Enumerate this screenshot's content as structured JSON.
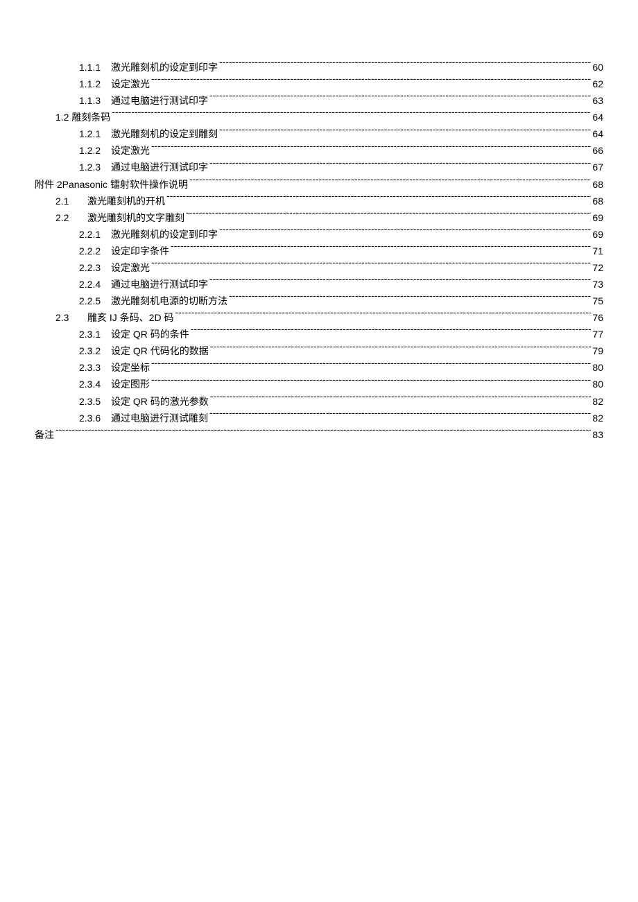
{
  "toc": [
    {
      "level": 2,
      "num": "1.1.1",
      "label": "激光雕刻机的设定到印字",
      "page": "60"
    },
    {
      "level": 2,
      "num": "1.1.2",
      "label": "设定激光",
      "page": "62"
    },
    {
      "level": 2,
      "num": "1.1.3",
      "label": "通过电脑进行测试印字",
      "page": "63"
    },
    {
      "level": 1,
      "num": "1.2",
      "label": "雕刻条码",
      "page": "64",
      "joinNum": true
    },
    {
      "level": 2,
      "num": "1.2.1",
      "label": "激光雕刻机的设定到雕刻",
      "page": "64"
    },
    {
      "level": 2,
      "num": "1.2.2",
      "label": "设定激光",
      "page": "66"
    },
    {
      "level": 2,
      "num": "1.2.3",
      "label": "通过电脑进行测试印字",
      "page": "67"
    },
    {
      "level": 0,
      "num": "",
      "label": "附件 2Panasonic 镭射软件操作说明",
      "page": "68"
    },
    {
      "level": 1,
      "num": "2.1",
      "label": "激光雕刻机的开机",
      "page": "68"
    },
    {
      "level": 1,
      "num": "2.2",
      "label": "激光雕刻机的文字雕刻",
      "page": "69"
    },
    {
      "level": 2,
      "num": "2.2.1",
      "label": "激光雕刻机的设定到印字",
      "page": "69"
    },
    {
      "level": 2,
      "num": "2.2.2",
      "label": "设定印字条件",
      "page": "71"
    },
    {
      "level": 2,
      "num": "2.2.3",
      "label": "设定激光",
      "page": "72"
    },
    {
      "level": 2,
      "num": "2.2.4",
      "label": "通过电脑进行测试印字",
      "page": "73"
    },
    {
      "level": 2,
      "num": "2.2.5",
      "label": "激光雕刻机电源的切断方法",
      "page": "75"
    },
    {
      "level": 1,
      "num": "2.3",
      "label": "雕亥 IJ 条码、2D 码",
      "page": "76"
    },
    {
      "level": 2,
      "num": "2.3.1",
      "label": "设定 QR 码的条件",
      "page": "77"
    },
    {
      "level": 2,
      "num": "2.3.2",
      "label": "设定 QR 代码化的数据",
      "page": "79"
    },
    {
      "level": 2,
      "num": "2.3.3",
      "label": "设定坐标",
      "page": "80"
    },
    {
      "level": 2,
      "num": "2.3.4",
      "label": "设定图形",
      "page": "80"
    },
    {
      "level": 2,
      "num": "2.3.5",
      "label": "设定 QR 码的激光参数",
      "page": "82"
    },
    {
      "level": 2,
      "num": "2.3.6",
      "label": "通过电脑进行测试雕刻",
      "page": "82"
    },
    {
      "level": 0,
      "num": "",
      "label": "备注",
      "page": "83"
    }
  ]
}
